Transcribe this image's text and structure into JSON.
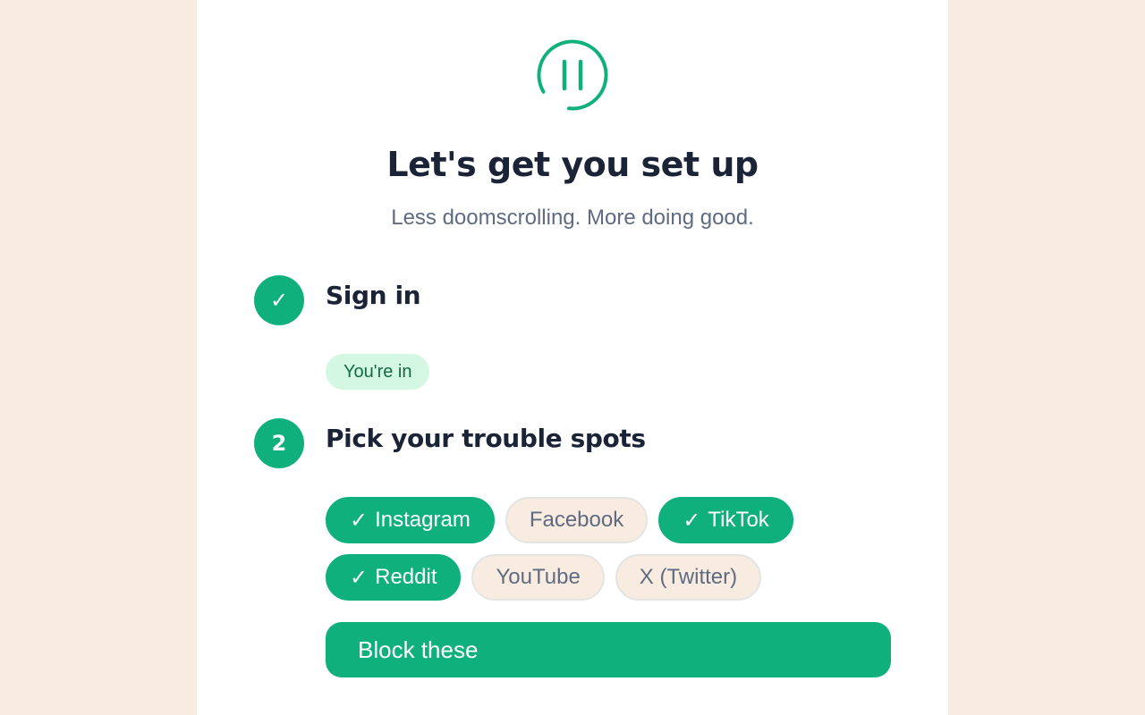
{
  "header": {
    "logo_icon": "pause-circle-icon",
    "title": "Let's get you set up",
    "subtitle": "Less doomscrolling. More doing good."
  },
  "colors": {
    "accent": "#10b07d",
    "background": "#f8ebdf",
    "title": "#1b2437",
    "muted": "#5f6b82"
  },
  "steps": [
    {
      "badge": "✓",
      "badge_icon": "check-icon",
      "title": "Sign in",
      "status": "You're in"
    },
    {
      "badge": "2",
      "title": "Pick your trouble spots",
      "options": [
        {
          "label": "Instagram",
          "selected": true
        },
        {
          "label": "Facebook",
          "selected": false
        },
        {
          "label": "TikTok",
          "selected": true
        },
        {
          "label": "Reddit",
          "selected": true
        },
        {
          "label": "YouTube",
          "selected": false
        },
        {
          "label": "X (Twitter)",
          "selected": false
        }
      ],
      "check_mark": "✓",
      "action_label": "Block these"
    }
  ]
}
